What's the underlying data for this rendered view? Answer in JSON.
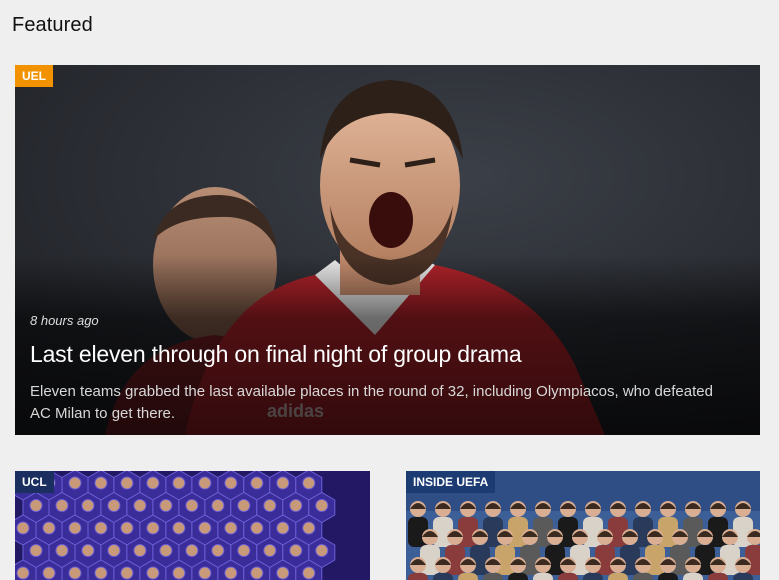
{
  "section": {
    "title": "Featured"
  },
  "hero": {
    "badge": "UEL",
    "time": "8 hours ago",
    "title": "Last eleven through on final night of group drama",
    "description": "Eleven teams grabbed the last available places in the round of 32, including Olympiacos, who defeated AC Milan to get there.",
    "kit_text": "adidas",
    "badge_color": "#f39200"
  },
  "cards": [
    {
      "badge": "UCL",
      "badge_color": "#1a2f5f"
    },
    {
      "badge": "INSIDE UEFA",
      "badge_color": "#1d3b73"
    }
  ]
}
